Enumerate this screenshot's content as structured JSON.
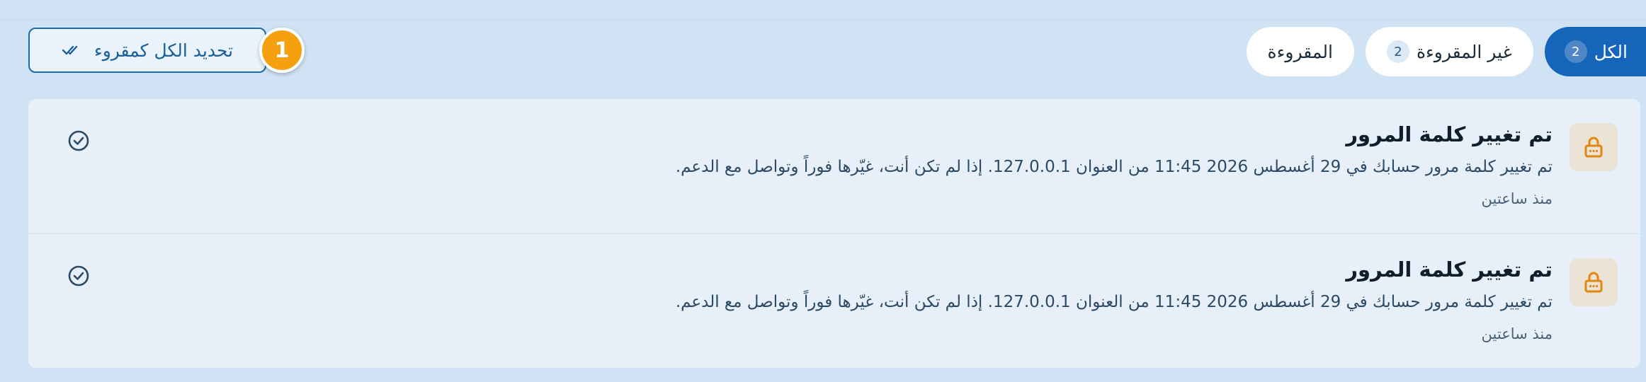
{
  "tabs": [
    {
      "label": "الكل",
      "count": "2",
      "active": true
    },
    {
      "label": "غير المقروءة",
      "count": "2",
      "active": false
    },
    {
      "label": "المقروءة",
      "count": "",
      "active": false
    }
  ],
  "actions": {
    "mark_all_label": "تحديد الكل كمقروء",
    "step_badge": "1"
  },
  "notifications": [
    {
      "icon": "lock-icon",
      "title": "تم تغيير كلمة المرور",
      "body": "تم تغيير كلمة مرور حسابك في 29 أغسطس 2026 11:45 من العنوان 127.0.0.1. إذا لم تكن أنت، غيّرها فوراً وتواصل مع الدعم.",
      "time": "منذ ساعتين"
    },
    {
      "icon": "lock-icon",
      "title": "تم تغيير كلمة المرور",
      "body": "تم تغيير كلمة مرور حسابك في 29 أغسطس 2026 11:45 من العنوان 127.0.0.1. إذا لم تكن أنت، غيّرها فوراً وتواصل مع الدعم.",
      "time": "منذ ساعتين"
    }
  ],
  "colors": {
    "accent": "#1565ba",
    "badge": "#f5a00f",
    "background": "#cfe3f5",
    "lock": "#e3870f"
  }
}
